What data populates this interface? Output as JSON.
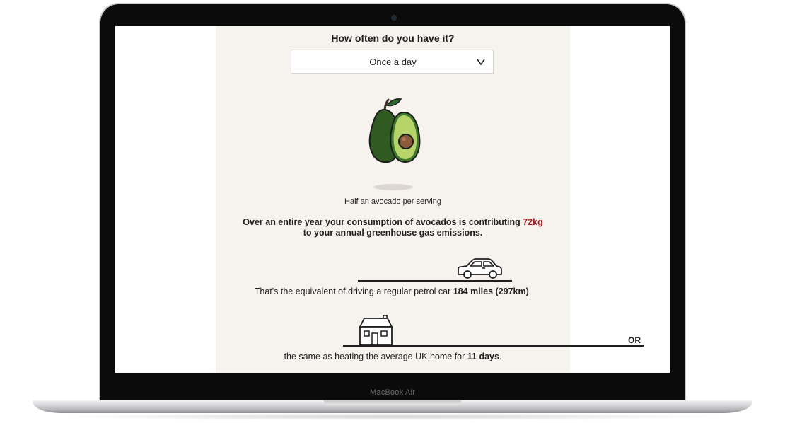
{
  "question": "How often do you have it?",
  "frequency_select": {
    "value": "Once a day"
  },
  "serving_label": "Half an avocado per serving",
  "summary": {
    "prefix": "Over an entire year your consumption of avocados is contributing",
    "amount": "72kg",
    "suffix": "to your annual greenhouse gas emissions."
  },
  "car_equivalent": {
    "prefix": "That's the equivalent of driving a regular petrol car",
    "distance": "184 miles (297km)",
    "suffix": "."
  },
  "or_label": "OR",
  "home_equivalent": {
    "prefix": "the same as heating the average UK home for",
    "duration": "11 days",
    "suffix": "."
  },
  "device_label": "MacBook Air",
  "colors": {
    "panel_background": "#f6f2ee",
    "highlight": "#a8141b",
    "text": "#1f1f1f",
    "avocado_dark": "#2f5a22",
    "avocado_light": "#b6d46a",
    "avocado_seed": "#8a5a3a"
  },
  "icons": [
    "chevron-down-icon",
    "avocado-icon",
    "car-icon",
    "house-icon"
  ]
}
